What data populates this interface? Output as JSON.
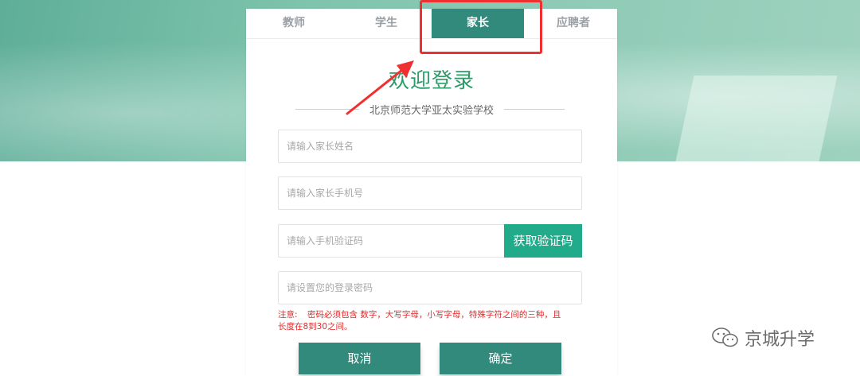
{
  "tabs": [
    {
      "label": "教师",
      "active": false
    },
    {
      "label": "学生",
      "active": false
    },
    {
      "label": "家长",
      "active": true
    },
    {
      "label": "应聘者",
      "active": false
    }
  ],
  "title": "欢迎登录",
  "school": "北京师范大学亚太实验学校",
  "form": {
    "name_placeholder": "请输入家长姓名",
    "phone_placeholder": "请输入家长手机号",
    "code_placeholder": "请输入手机验证码",
    "code_button": "获取验证码",
    "password_placeholder": "请设置您的登录密码"
  },
  "notice": {
    "label": "注意:",
    "text_line1": "密码必须包含 数字，大写字母，小写字母，特殊字符之间的三种，且",
    "text_line2": "长度在8到30之间。"
  },
  "buttons": {
    "cancel": "取消",
    "confirm": "确定"
  },
  "watermark": "京城升学",
  "colors": {
    "primary": "#318a7c",
    "code_button": "#22ab8a",
    "title": "#2f9a68",
    "notice": "#e02a2a",
    "annotation": "#f03030"
  }
}
